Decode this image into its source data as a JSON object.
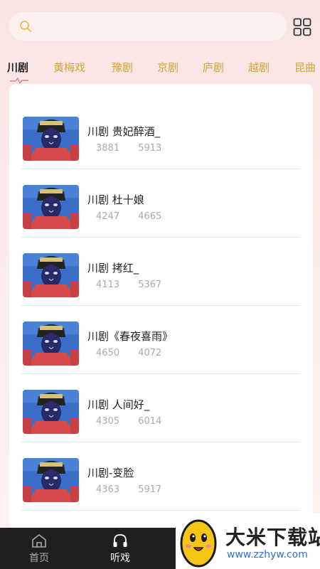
{
  "search": {
    "placeholder": ""
  },
  "tabs": [
    {
      "label": "川剧",
      "active": true
    },
    {
      "label": "黄梅戏"
    },
    {
      "label": "豫剧"
    },
    {
      "label": "京剧"
    },
    {
      "label": "庐剧"
    },
    {
      "label": "越剧"
    },
    {
      "label": "昆曲"
    }
  ],
  "items": [
    {
      "title": "川剧 贵妃醉酒_",
      "stat1": "3881",
      "stat2": "5913"
    },
    {
      "title": "川剧 杜十娘",
      "stat1": "4247",
      "stat2": "4665"
    },
    {
      "title": "川剧 拷红_",
      "stat1": "4113",
      "stat2": "5367"
    },
    {
      "title": "川剧《春夜喜雨》",
      "stat1": "4650",
      "stat2": "4072"
    },
    {
      "title": "川剧 人间好_",
      "stat1": "4305",
      "stat2": "6014"
    },
    {
      "title": "川剧-变脸",
      "stat1": "4363",
      "stat2": "5917"
    }
  ],
  "nav": {
    "home_label": "首页",
    "listen_label": "听戏"
  },
  "watermark": {
    "title": "大米下载站",
    "url": "www.zzhyw.com"
  },
  "colors": {
    "tab_inactive": "#d4a437",
    "nav_bg": "#1f1f1f",
    "watermark_url": "#2f6fd8"
  }
}
